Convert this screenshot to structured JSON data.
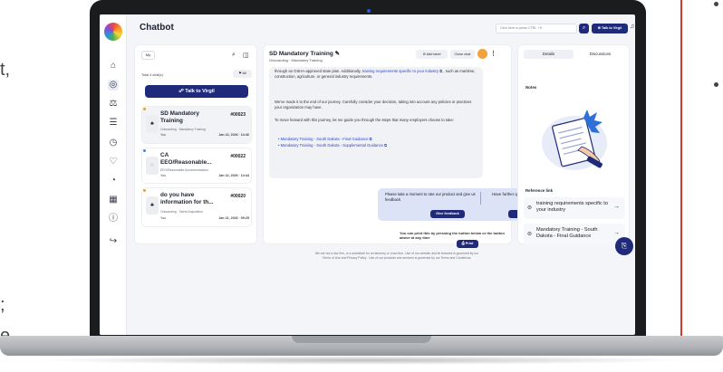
{
  "app": {
    "title": "Chatbot",
    "search_placeholder": "Click here or press CTRL + K",
    "talk_to_virgil_top": "⊕ Talk to Virgil"
  },
  "rail": {
    "icons": [
      "home-icon",
      "chat-icon",
      "scale-icon",
      "list-icon",
      "clock-icon",
      "cart-icon",
      "gauge-icon",
      "grid-icon",
      "info-icon",
      "logout-icon"
    ]
  },
  "list_panel": {
    "tab_label": "My",
    "total_label": "Total 4 chat(s)",
    "filter_label": "All",
    "talk_button": "Talk to Virgil",
    "chats": [
      {
        "title": "SD Mandatory Training",
        "id": "#00023",
        "sub": "Onboarding · Mandatory Training",
        "who": "You",
        "date": "Jan 22, 2026 · 14:46",
        "dot": "#f59a23"
      },
      {
        "title": "CA EEO/Reasonable...",
        "id": "#00022",
        "sub": "EEO/Reasonable Accommodations",
        "who": "You",
        "date": "Jan 22, 2026 · 14:44",
        "dot": "#2f8fde"
      },
      {
        "title": "do you have information for th...",
        "id": "#00020",
        "sub": "Onboarding · Talent Acquisition",
        "who": "You",
        "date": "Jan 21, 2026 · 09:25",
        "dot": "#f59a23"
      }
    ]
  },
  "chat": {
    "title": "SD Mandatory Training",
    "subtitle": "Onboarding · Mandatory Training",
    "add_label": "Add label",
    "close_chat": "Close chat",
    "para1_prefix": "through an OSHA-approved state plan. Additionally,",
    "para1_link": "training requirements specific to your industry",
    "para1_suffix": ", such as maritime, construction, agriculture, or general industry requirements.",
    "para2": "We've made it to the end of our journey. Carefully consider your decision, taking into account any policies or practices your organization may have.",
    "para3": "To move forward with this journey, let me guide you through the steps that many employers choose to take:",
    "links": [
      "Mandatory Training - South Dakota - Final Guidance",
      "Mandatory Training - South Dakota - Supplemental Guidance"
    ],
    "feedback_text": "Please take a moment to rate our product and give us feedback.",
    "feedback_question": "Have further questions?",
    "give_feedback": "Give feedback",
    "contact_expert": "Contact our VirgilHR Expert",
    "print_note": "You can print this by pressing the button below or the button above at any time",
    "print_label": "Print"
  },
  "side": {
    "tab_details": "Details",
    "tab_discussions": "Discussions",
    "notes_label": "Notes",
    "reference_label": "Reference link",
    "refs": [
      "training requirements specific to your industry",
      "Mandatory Training - South Dakota - Final Guidance"
    ]
  },
  "footer": {
    "line1": "We are not a law firm, or a substitute for an attorney or a law firm. Use of our website and its features is governed by our",
    "line2": "Terms of Use and Privacy Policy . Use of our products and services is governed by our Terms and Conditions."
  },
  "slide_fragments": [
    "t,",
    ";",
    "e"
  ],
  "colors": {
    "brand": "#1f2b7a",
    "accent_red": "#d43b2e",
    "link": "#2b47c8"
  }
}
